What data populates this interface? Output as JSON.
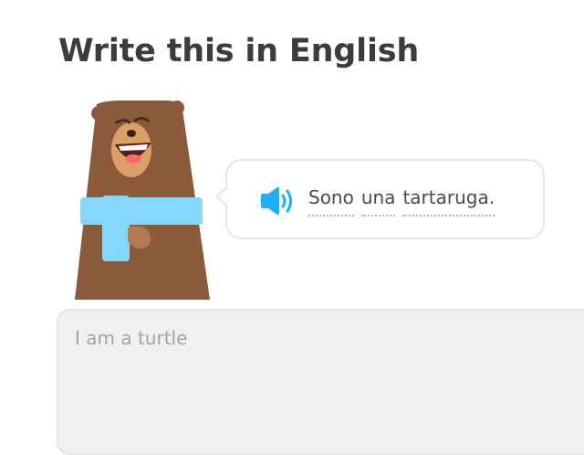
{
  "lesson": {
    "instruction": "Write this in English"
  },
  "prompt": {
    "words": [
      "Sono",
      "una",
      "tartaruga."
    ],
    "audio_icon": "speaker-icon"
  },
  "character": {
    "icon": "bear-character"
  },
  "answer": {
    "value": "",
    "placeholder": "I am a turtle"
  },
  "colors": {
    "title": "#3c3c3c",
    "speaker": "#1cb0f6",
    "bear_fur": "#8a5a3b",
    "scarf": "#84d8ff",
    "input_bg": "#f0f0f0"
  }
}
